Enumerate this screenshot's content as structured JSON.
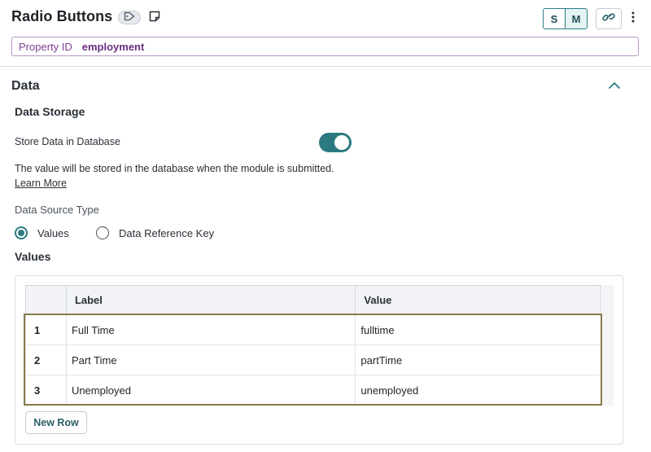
{
  "header": {
    "title": "Radio Buttons",
    "tag_icon": "tag-icon",
    "note_icon": "note-icon",
    "size_buttons": [
      "S",
      "M"
    ],
    "selected_size": "M",
    "link_icon": "link-icon",
    "more_icon": "vertical-dots-icon",
    "property_id_label": "Property ID",
    "property_id_value": "employment"
  },
  "section": {
    "title": "Data",
    "collapse_icon": "chevron-up-icon"
  },
  "data_storage": {
    "title": "Data Storage",
    "store_label": "Store Data in Database",
    "store_enabled": true,
    "help_text": "The value will be stored in the database when the module is submitted.",
    "learn_more": "Learn More"
  },
  "data_source": {
    "title": "Data Source Type",
    "options": [
      "Values",
      "Data Reference Key"
    ],
    "selected": "Values"
  },
  "values": {
    "title": "Values",
    "columns": [
      "Label",
      "Value"
    ],
    "rows": [
      {
        "num": "1",
        "label": "Full Time",
        "value": "fulltime"
      },
      {
        "num": "2",
        "label": "Part Time",
        "value": "partTime"
      },
      {
        "num": "3",
        "label": "Unemployed",
        "value": "unemployed"
      }
    ],
    "new_row_label": "New Row"
  },
  "colors": {
    "accent": "#2b7a80",
    "property_border": "#b99bc7",
    "selection_border": "#8a7a4a"
  }
}
